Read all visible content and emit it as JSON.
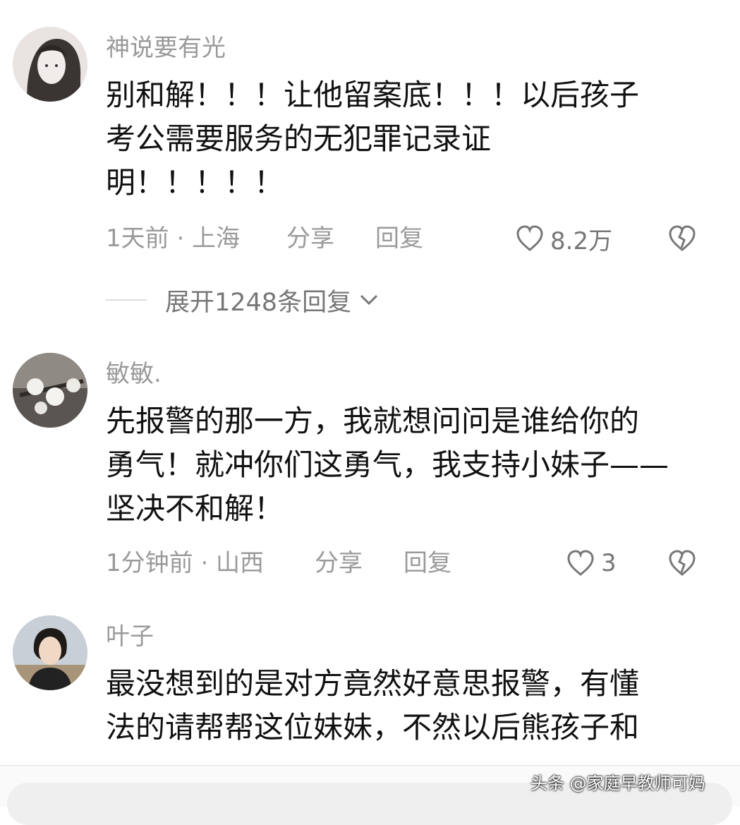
{
  "comments": [
    {
      "username": "神说要有光",
      "text": "别和解！！！让他留案底！！！以后孩子\n考公需要服务的无犯罪记录证\n明！！！！！",
      "time_location": "1天前 · 上海",
      "share_label": "分享",
      "reply_label": "回复",
      "likes": "8.2万",
      "expand_label": "展开1248条回复"
    },
    {
      "username": "敏敏.",
      "text": "先报警的那一方，我就想问问是谁给你的\n勇气！就冲你们这勇气，我支持小妹子——\n坚决不和解！",
      "time_location": "1分钟前 · 山西",
      "share_label": "分享",
      "reply_label": "回复",
      "likes": "3"
    },
    {
      "username": "叶子",
      "text": "最没想到的是对方竟然好意思报警，有懂\n法的请帮帮这位妹妹，不然以后熊孩子和"
    }
  ],
  "watermark": "头条 @家庭早教师可妈",
  "icons": {
    "like": "heart-outline-icon",
    "dislike": "broken-heart-icon",
    "expand": "chevron-down-icon"
  }
}
